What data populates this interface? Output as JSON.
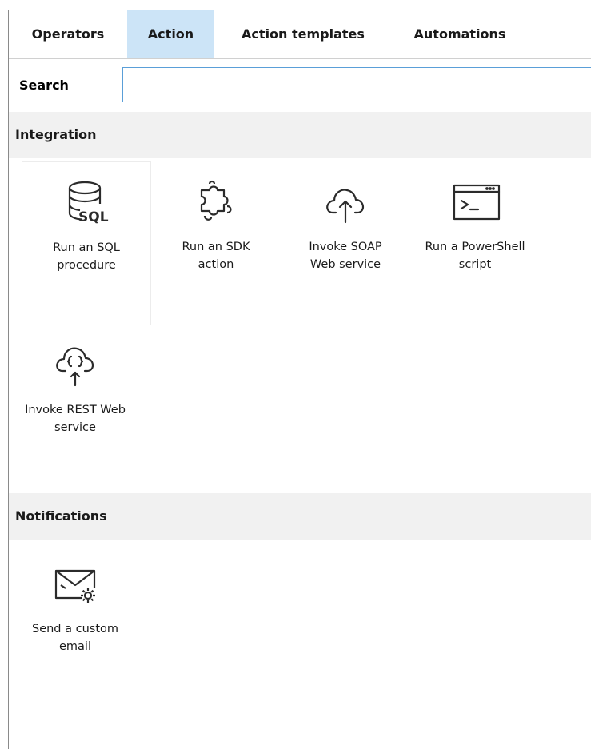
{
  "tabs": [
    {
      "label": "Operators",
      "active": false
    },
    {
      "label": "Action",
      "active": true
    },
    {
      "label": "Action templates",
      "active": false
    },
    {
      "label": "Automations",
      "active": false
    }
  ],
  "search": {
    "label": "Search",
    "value": "",
    "placeholder": ""
  },
  "sections": [
    {
      "title": "Integration",
      "items": [
        {
          "label": "Run an SQL\nprocedure",
          "icon": "sql-database-icon"
        },
        {
          "label": "Run an SDK\naction",
          "icon": "puzzle-icon"
        },
        {
          "label": "Invoke SOAP\nWeb service",
          "icon": "cloud-upload-icon"
        },
        {
          "label": "Run a PowerShell\nscript",
          "icon": "terminal-window-icon"
        },
        {
          "label": "Invoke REST Web\nservice",
          "icon": "cloud-braces-icon"
        }
      ]
    },
    {
      "title": "Notifications",
      "items": [
        {
          "label": "Send a custom\nemail",
          "icon": "email-gear-icon"
        }
      ]
    }
  ],
  "sql_icon_text": "SQL",
  "colors": {
    "active_tab": "#cce4f7",
    "section_header": "#f1f1f1",
    "search_border": "#5a9fd8"
  }
}
